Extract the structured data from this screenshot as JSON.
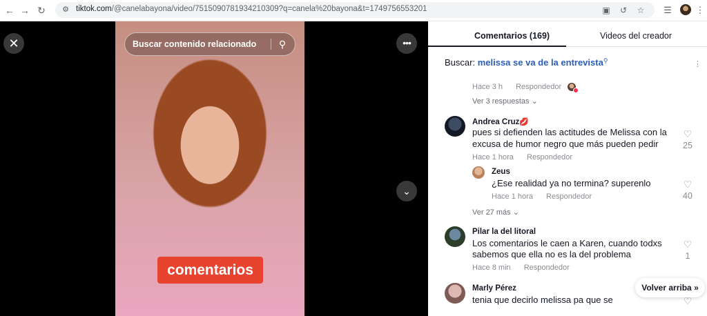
{
  "browser": {
    "url_host": "tiktok.com",
    "url_path": "/@canelabayona/video/7515090781934210309?q=canela%20bayona&t=1749756553201"
  },
  "video": {
    "search_placeholder": "Buscar contenido relacionado",
    "caption": "comentarios"
  },
  "panel": {
    "tabs": [
      {
        "label": "Comentarios (169)",
        "active": true
      },
      {
        "label": "Videos del creador",
        "active": false
      }
    ],
    "search_label": "Buscar:",
    "search_query": "melissa se va de la entrevista",
    "prev_comment": {
      "time": "Hace 3 h",
      "reply_label": "Respondedor",
      "view_replies": "Ver 3 respuestas"
    },
    "comments": [
      {
        "user": "Andrea Cruz",
        "badge": "💋",
        "text_line1": "pues si defienden las actitudes de Melissa con la",
        "text_line2": "excusa de humor negro que más pueden pedir",
        "time": "Hace 1 hora",
        "reply_label": "Respondedor",
        "likes": "25",
        "reply": {
          "user": "Zeus",
          "text": "¿Ese realidad ya no termina? superenlo",
          "time": "Hace 1 hora",
          "reply_label": "Respondedor",
          "likes": "40"
        },
        "view_more": "Ver 27 más"
      },
      {
        "user": "Pilar la del litoral",
        "text_line1": "Los comentarios le caen a Karen, cuando todxs",
        "text_line2": "sabemos que ella no es la del problema",
        "time": "Hace 8 min",
        "reply_label": "Respondedor",
        "likes": "1"
      },
      {
        "user": "Marly Pérez",
        "text_line1": "tenia que decirlo melissa pa que se"
      }
    ],
    "back_to_top": "Volver arriba"
  },
  "colors": {
    "accent_blue": "#2b5db9",
    "caption_bg": "#e8432f",
    "brand_red": "#fe2c55"
  }
}
